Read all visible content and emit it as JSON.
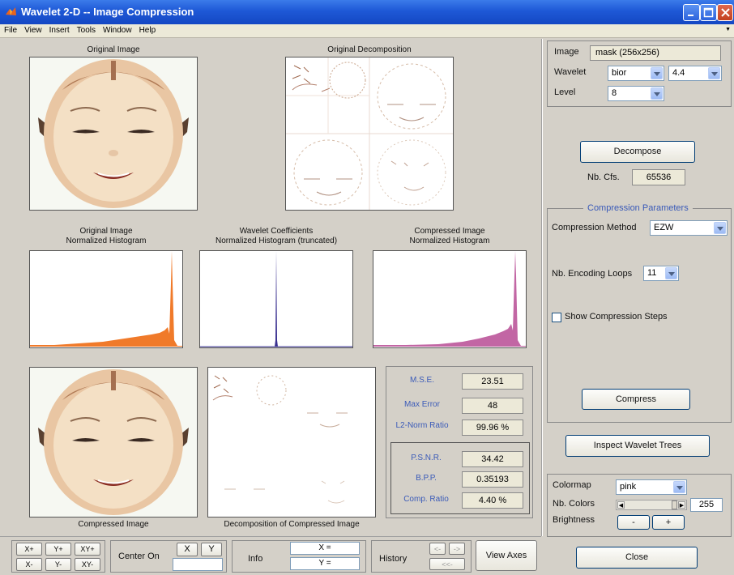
{
  "window": {
    "title": "Wavelet 2-D -- Image Compression",
    "controls": [
      "minimize",
      "maximize",
      "close"
    ]
  },
  "menu": [
    "File",
    "View",
    "Insert",
    "Tools",
    "Window",
    "Help"
  ],
  "plots": {
    "original_image": "Original Image",
    "original_decomposition": "Original Decomposition",
    "hist_original_line1": "Original Image",
    "hist_original_line2": "Normalized Histogram",
    "hist_coeffs_line1": "Wavelet Coefficients",
    "hist_coeffs_line2": "Normalized Histogram (truncated)",
    "hist_compressed_line1": "Compressed Image",
    "hist_compressed_line2": "Normalized Histogram",
    "compressed_image": "Compressed Image",
    "compressed_decomposition": "Decomposition of Compressed Image"
  },
  "colors": {
    "hist_original": "#f07a2a",
    "hist_coeffs": "#3a3090",
    "hist_compressed": "#c266a4",
    "label_blue": "#3a5ab8"
  },
  "stats": {
    "mse_label": "M.S.E.",
    "mse": "23.51",
    "maxerr_label": "Max Error",
    "maxerr": "48",
    "l2_label": "L2-Norm Ratio",
    "l2": "99.96 %",
    "psnr_label": "P.S.N.R.",
    "psnr": "34.42",
    "bpp_label": "B.P.P.",
    "bpp": "0.35193",
    "comp_label": "Comp. Ratio",
    "comp": "4.40 %"
  },
  "right": {
    "image_label": "Image",
    "image_value": "mask  (256x256)",
    "wavelet_label": "Wavelet",
    "wavelet_family": "bior",
    "wavelet_number": "4.4",
    "level_label": "Level",
    "level_value": "8",
    "decompose": "Decompose",
    "nbcfs_label": "Nb. Cfs.",
    "nbcfs_value": "65536",
    "comp_params_title": "Compression Parameters",
    "method_label": "Compression Method",
    "method_value": "EZW",
    "loops_label": "Nb. Encoding Loops",
    "loops_value": "11",
    "show_steps": "Show Compression Steps",
    "compress": "Compress",
    "inspect": "Inspect Wavelet Trees",
    "colormap_label": "Colormap",
    "colormap_value": "pink",
    "nbcolors_label": "Nb. Colors",
    "nbcolors_value": "255",
    "brightness_label": "Brightness",
    "bright_minus": "-",
    "bright_plus": "+",
    "close": "Close"
  },
  "bottom": {
    "xplus": "X+",
    "yplus": "Y+",
    "xyplus": "XY+",
    "xminus": "X-",
    "yminus": "Y-",
    "xyminus": "XY-",
    "center_on": "Center On",
    "cx": "X",
    "cy": "Y",
    "info": "Info",
    "xeq": "X =",
    "yeq": "Y =",
    "history": "History",
    "hist_back": "<-",
    "hist_fwd": "->",
    "hist_first": "<<-",
    "view_axes": "View Axes"
  }
}
